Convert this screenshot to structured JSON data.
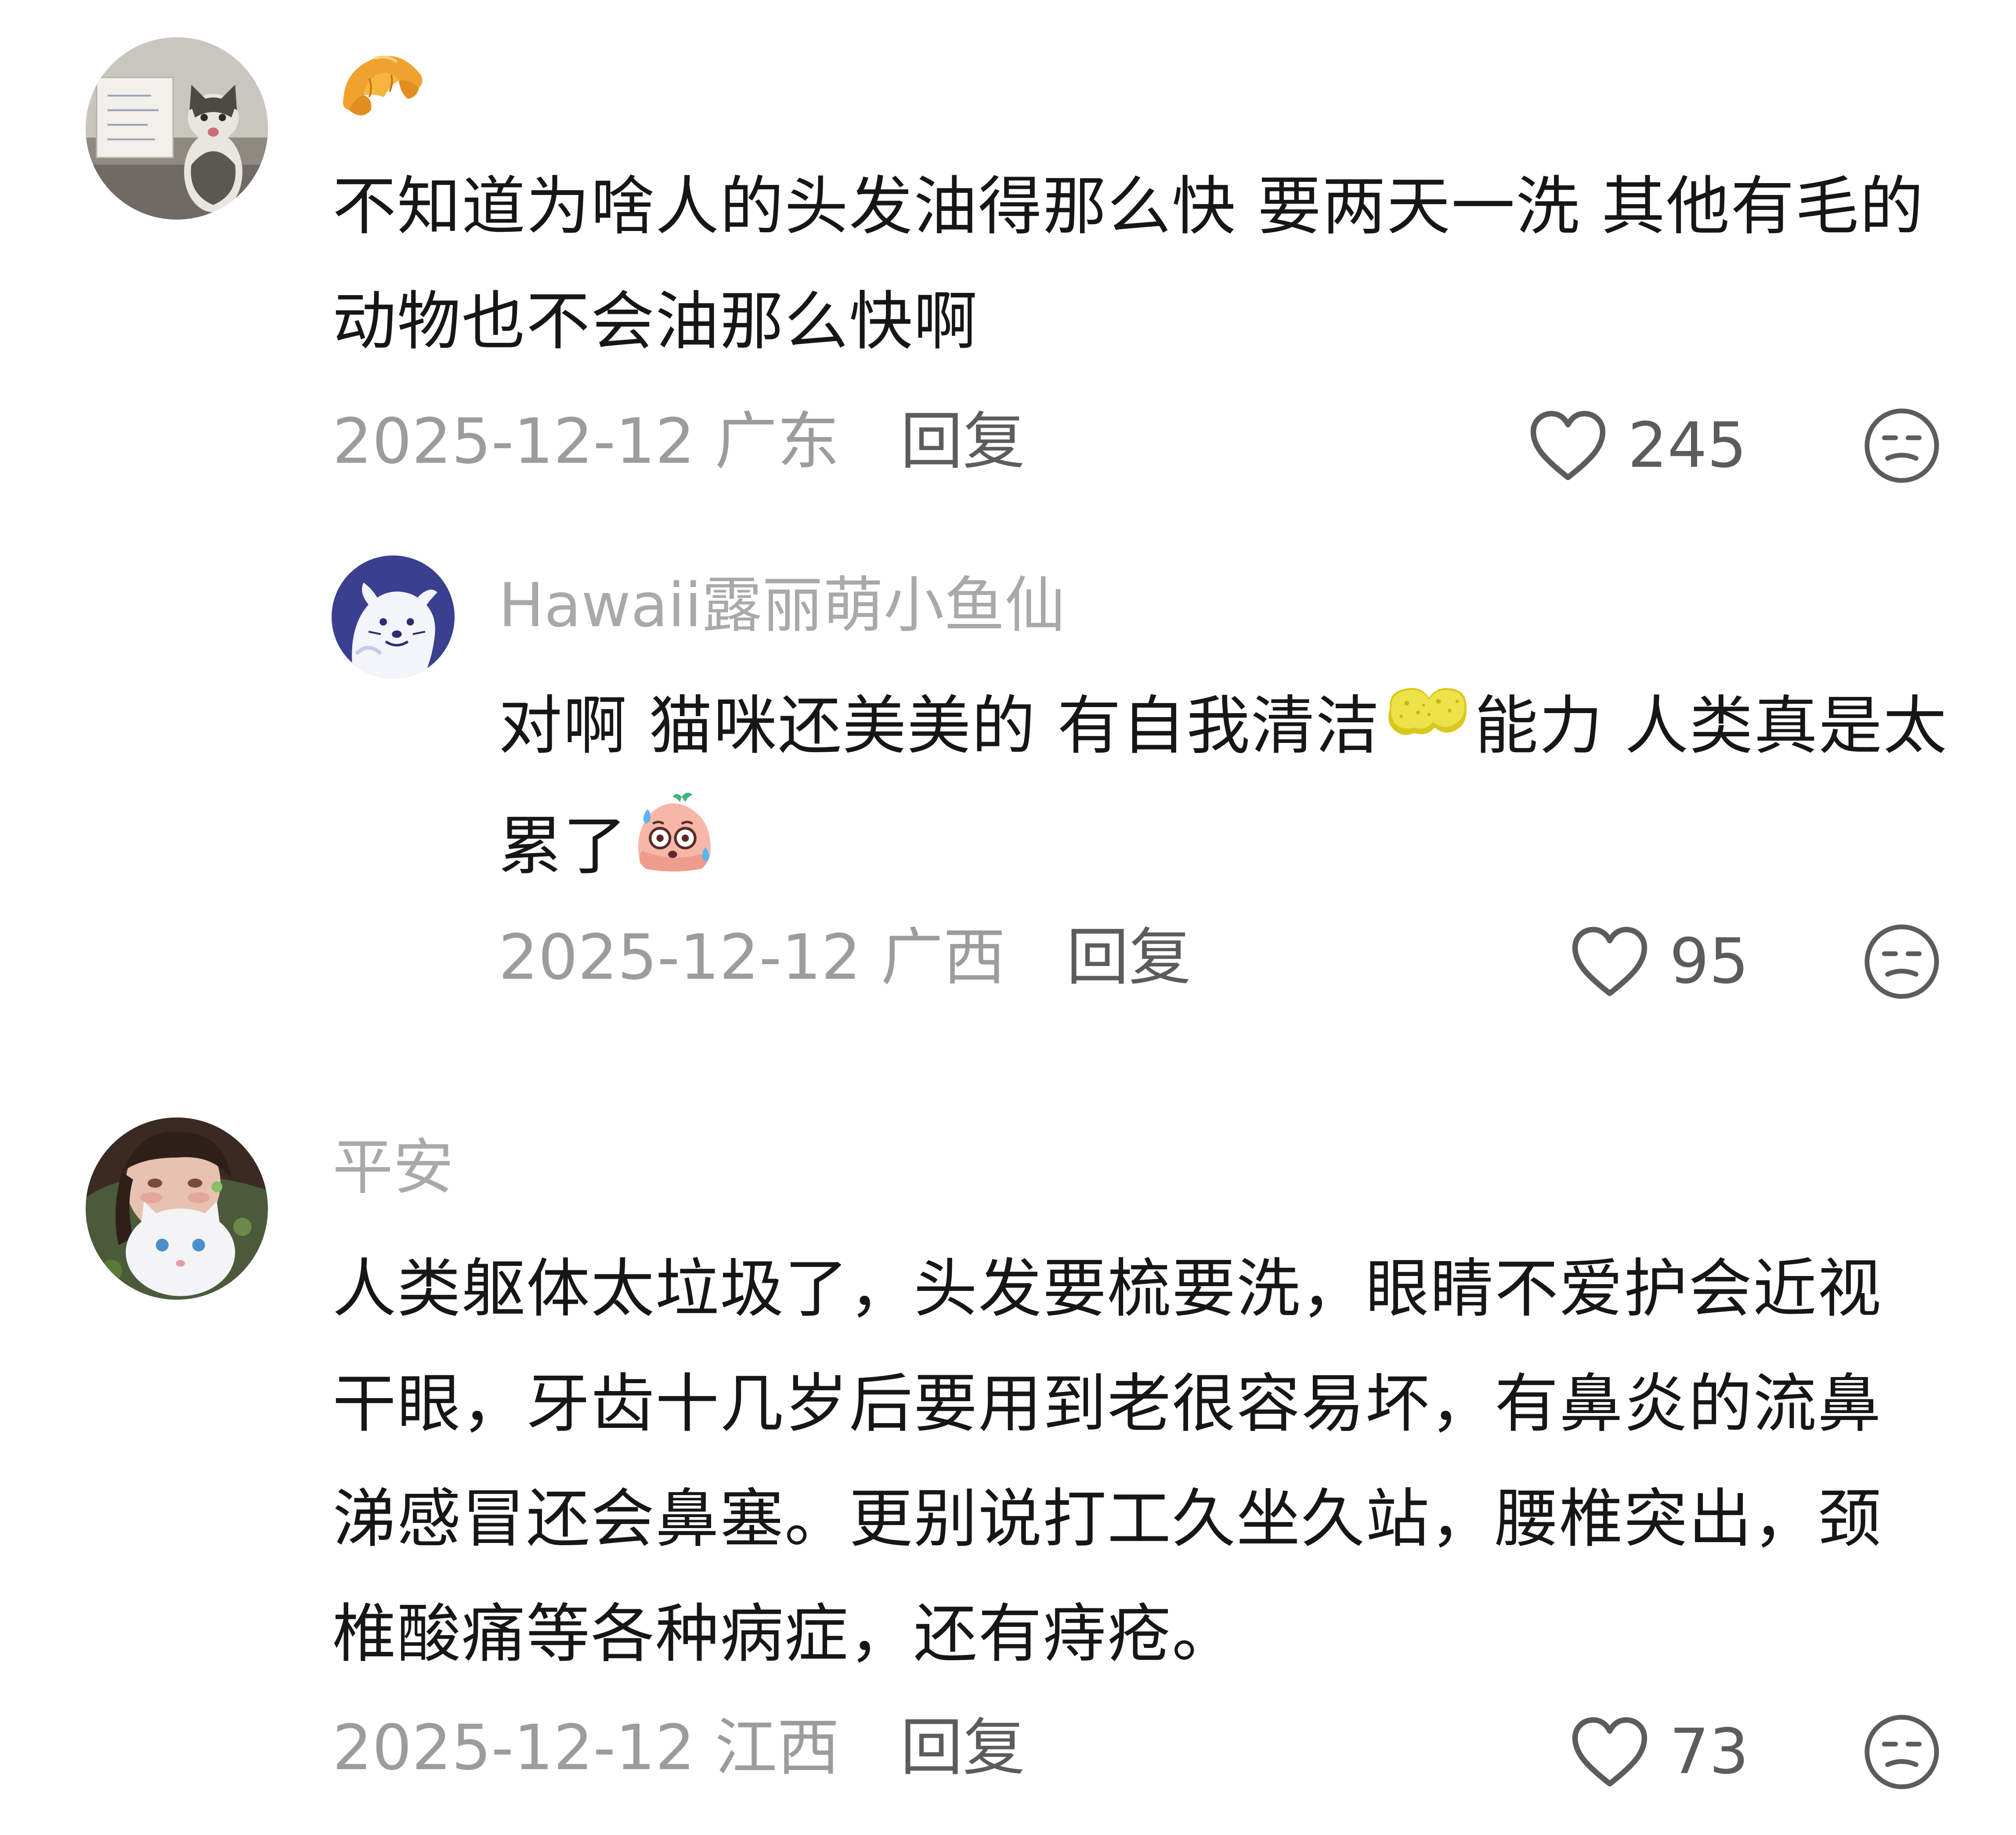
{
  "comments": [
    {
      "username_emoji": "croissant-emoji",
      "text": "不知道为啥人的头发油得那么快 要两天一洗 其他有毛的动物也不会油那么快啊",
      "date": "2025-12-12",
      "location": "广东",
      "reply_label": "回复",
      "likes": "245",
      "replies": [
        {
          "username": "Hawaii露丽萌小鱼仙",
          "text_part1": "对啊 猫咪还美美的 有自我清洁",
          "emoji1": "sponge-emoji",
          "text_part2": "能力 人类真是太累了",
          "emoji2": "sweat-face-emoji",
          "date": "2025-12-12",
          "location": "广西",
          "reply_label": "回复",
          "likes": "95"
        }
      ]
    },
    {
      "username": "平安",
      "text": "人类躯体太垃圾了，头发要梳要洗，眼睛不爱护会近视干眼，牙齿十几岁后要用到老很容易坏，有鼻炎的流鼻涕感冒还会鼻塞。更别说打工久坐久站，腰椎突出，颈椎酸痛等各种病症，还有痔疮。",
      "date": "2025-12-12",
      "location": "江西",
      "reply_label": "回复",
      "likes": "73"
    }
  ]
}
